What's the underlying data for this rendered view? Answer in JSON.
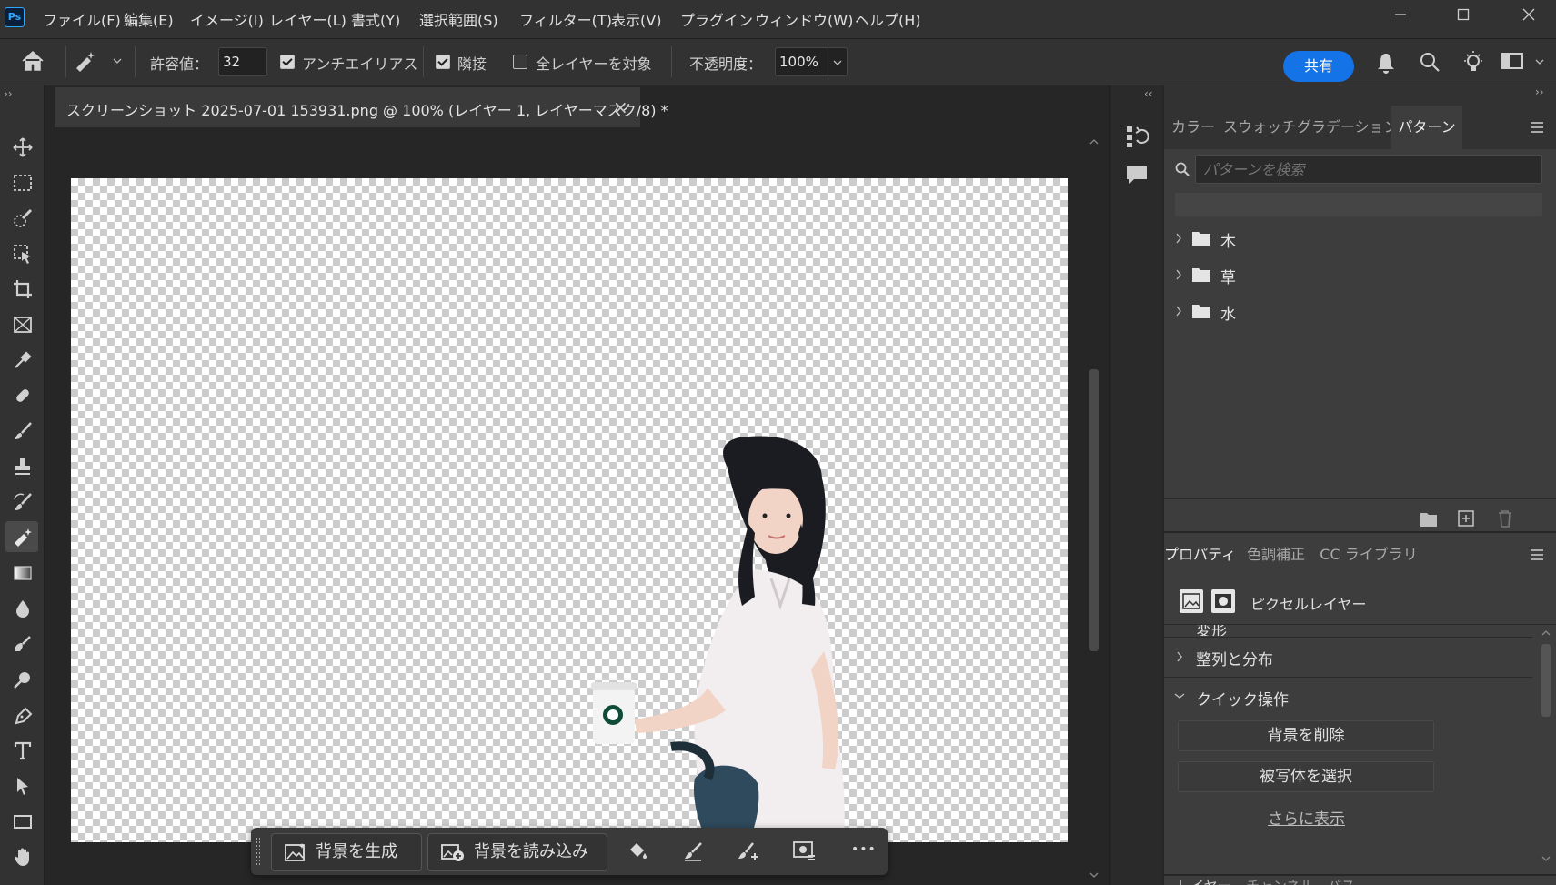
{
  "app": {
    "logo": "Ps"
  },
  "menubar": {
    "items": [
      "ファイル(F)",
      "編集(E)",
      "イメージ(I)",
      "レイヤー(L)",
      "書式(Y)",
      "選択範囲(S)",
      "フィルター(T)",
      "表示(V)",
      "プラグイン",
      "ウィンドウ(W)",
      "ヘルプ(H)"
    ]
  },
  "options": {
    "tolerance_label": "許容値：",
    "tolerance_value": "32",
    "antialias_label": "アンチエイリアス",
    "contiguous_label": "隣接",
    "all_layers_label": "全レイヤーを対象",
    "opacity_label": "不透明度：",
    "opacity_value": "100%",
    "share_label": "共有"
  },
  "document": {
    "tab_title": "スクリーンショット 2025-07-01 153931.png @ 100% (レイヤー 1, レイヤーマスク/8) *",
    "close_glyph": "×"
  },
  "taskbar": {
    "generate_bg": "背景を生成",
    "import_bg": "背景を読み込み",
    "more_glyph": "•••"
  },
  "patterns_panel": {
    "tabs": [
      "カラー",
      "スウォッチ",
      "グラデーション",
      "パターン"
    ],
    "active_tab": "パターン",
    "search_placeholder": "パターンを検索",
    "folders": [
      "木",
      "草",
      "水"
    ]
  },
  "properties_panel": {
    "tabs": [
      "プロパティ",
      "色調補正",
      "CC ライブラリ"
    ],
    "active_tab": "プロパティ",
    "layer_type": "ピクセルレイヤー",
    "sections": {
      "transform_partial": "変形",
      "align": "整列と分布",
      "quick": "クイック操作"
    },
    "buttons": {
      "remove_bg": "背景を削除",
      "select_subject": "被写体を選択",
      "show_more": "さらに表示"
    }
  },
  "bottom_tabs": [
    "レイヤー",
    "チャンネル",
    "パス"
  ],
  "colors": {
    "accent": "#1473e6",
    "panel": "#323232",
    "canvas_bg": "#262626"
  },
  "icons": [
    "home-icon",
    "magic-eraser-icon",
    "bell-icon",
    "search-icon",
    "lightbulb-icon",
    "workspace-icon",
    "move-icon",
    "marquee-icon",
    "quick-select-icon",
    "object-select-icon",
    "crop-icon",
    "frame-icon",
    "eyedropper-icon",
    "healing-icon",
    "brush-icon",
    "stamp-icon",
    "history-brush-icon",
    "eraser-icon",
    "gradient-icon",
    "blur-icon",
    "smudge-icon",
    "dodge-icon",
    "pen-icon",
    "type-icon",
    "path-select-icon",
    "rectangle-icon",
    "hand-icon"
  ]
}
